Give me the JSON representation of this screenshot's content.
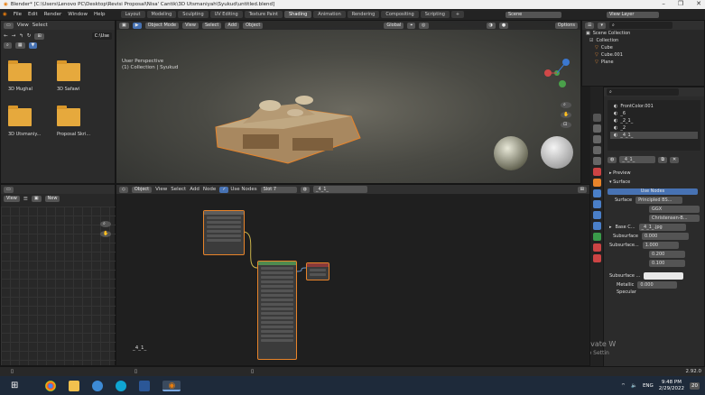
{
  "title_bar": {
    "text": "Blender* [C:\\Users\\Lenovo PC\\Desktop\\Revisi Proposal\\Nisa' Cantik\\3D Utsmaniyah\\Syukud\\untitled.blend]",
    "minimize": "–",
    "maximize": "❐",
    "close": "✕"
  },
  "menu": [
    "File",
    "Edit",
    "Render",
    "Window",
    "Help"
  ],
  "workspaces": [
    "Layout",
    "Modeling",
    "Sculpting",
    "UV Editing",
    "Texture Paint",
    "Shading",
    "Animation",
    "Rendering",
    "Compositing",
    "Scripting"
  ],
  "active_workspace": "Shading",
  "scene_label": "Scene",
  "view_layer_label": "View Layer",
  "file_browser": {
    "header": [
      "View",
      "Select"
    ],
    "filter_label": "C:\\Use",
    "items": [
      "3D Mughal",
      "3D Safawi",
      "3D Utsmaniy...",
      "Proposal Skri..."
    ]
  },
  "viewport": {
    "mode": "Object Mode",
    "menus": [
      "View",
      "Select",
      "Add",
      "Object"
    ],
    "orientation": "Global",
    "options": "Options",
    "info_line1": "User Perspective",
    "info_line2": "(1) Collection | Syukud"
  },
  "outliner": {
    "rows": [
      "Scene Collection",
      "Collection",
      "Cube",
      "Cube.001",
      "Plane"
    ]
  },
  "image_list": {
    "items": [
      "FrontColor.001",
      "_6",
      "_2_1_",
      "_2",
      "_4_1_"
    ]
  },
  "material_slot": "_4_1_",
  "properties": {
    "preview": "Preview",
    "surface": "Surface",
    "use_nodes": "Use Nodes",
    "surface_label": "Surface",
    "surface_value": "Principled BS...",
    "distribution": "GGX",
    "subsurface_method": "Christensen-B...",
    "base_color_label": "Base C...",
    "base_color_value": "_4_1_.jpg",
    "subsurface_label": "Subsurface",
    "subsurface_value": "0.000",
    "subsurface_radius_label": "Subsurface...",
    "radius_values": [
      "1.000",
      "0.200",
      "0.100"
    ],
    "subsurface_color_label": "Subsurface ...",
    "metallic_label": "Metallic",
    "metallic_value": "0.000",
    "specular_label": "Specular"
  },
  "image_editor": {
    "view": "View",
    "new": "New"
  },
  "node_editor": {
    "object": "Object",
    "menus": [
      "View",
      "Select",
      "Add",
      "Node"
    ],
    "use_nodes": "Use Nodes",
    "slot": "Slot 7",
    "material": "_4_1_",
    "material_name": "_4_1_"
  },
  "watermark": {
    "line1": "Activate W",
    "line2": "Go to Settin"
  },
  "status": {
    "version": "2.92.0"
  },
  "taskbar": {
    "lang": "ENG",
    "time": "9:48 PM",
    "date": "2/29/2022",
    "notif": "20"
  },
  "colors": {
    "accent_blue": "#4772b3",
    "orange": "#e8842a",
    "folder": "#e6a93d"
  }
}
